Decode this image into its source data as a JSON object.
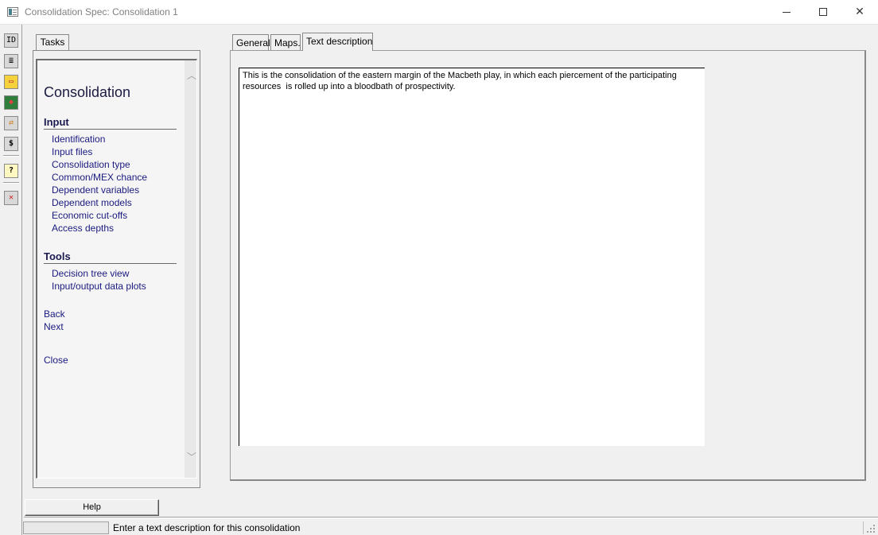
{
  "window": {
    "title": "Consolidation Spec: Consolidation 1",
    "minimize_icon": "minimize-icon",
    "maximize_icon": "maximize-icon",
    "close_icon": "close-icon"
  },
  "toolbar": {
    "items": [
      {
        "icon": "id-icon",
        "glyph": "ID"
      },
      {
        "icon": "list-icon",
        "glyph": "≣"
      },
      {
        "icon": "folder-icon",
        "glyph": "▭"
      },
      {
        "icon": "book-icon",
        "glyph": "◆"
      },
      {
        "icon": "transfer-icon",
        "glyph": "⇄"
      },
      {
        "icon": "dollar-icon",
        "glyph": "$"
      },
      {
        "icon": "help-icon",
        "glyph": "?"
      },
      {
        "icon": "close-icon",
        "glyph": "✕"
      }
    ]
  },
  "tasks": {
    "tab_label": "Tasks",
    "title": "Consolidation",
    "input_heading": "Input",
    "input_links": [
      "Identification",
      "Input files",
      "Consolidation type",
      "Common/MEX chance",
      "Dependent variables",
      "Dependent models",
      "Economic cut-offs",
      "Access depths"
    ],
    "tools_heading": "Tools",
    "tools_links": [
      "Decision tree view",
      "Input/output data plots"
    ],
    "back": "Back",
    "next": "Next",
    "close": "Close",
    "scroll_up_icon": "chevron-up-icon",
    "scroll_down_icon": "chevron-down-icon"
  },
  "main": {
    "tabs": [
      "General",
      "Maps.",
      "Text description"
    ],
    "active_tab": "Text description",
    "description": "This is the consolidation of the eastern margin of the Macbeth play, in which each piercement of the participating\nresources  is rolled up into a bloodbath of prospectivity."
  },
  "footer": {
    "help_label": "Help",
    "status": "Enter a text description for this consolidation"
  }
}
